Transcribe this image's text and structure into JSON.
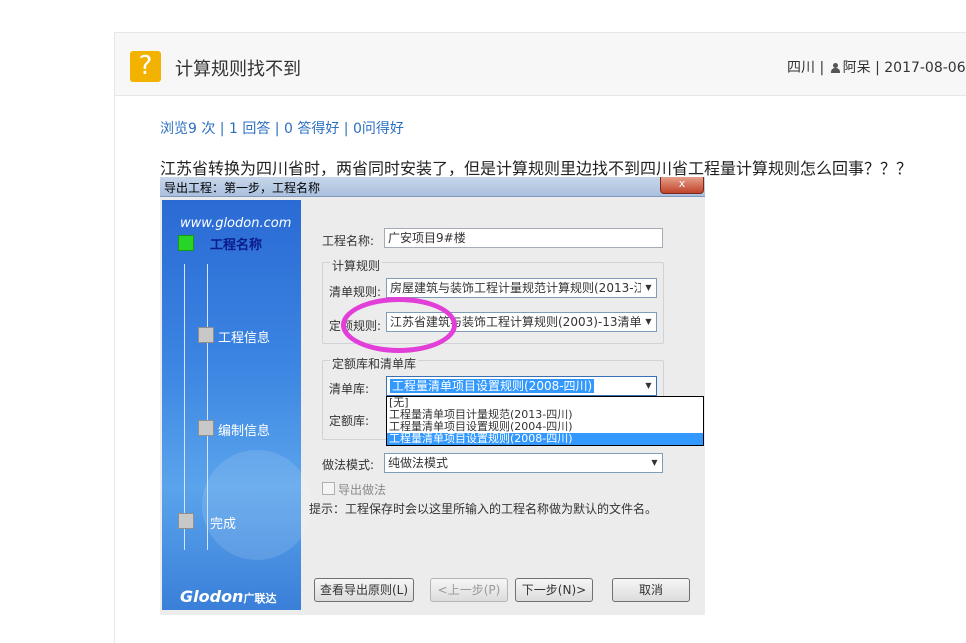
{
  "question": {
    "title": "计算规则找不到",
    "meta": {
      "region": "四川",
      "author": "阿呆",
      "date": "2017-08-06"
    },
    "stats": {
      "views": "浏览9 次",
      "answers": "1 回答",
      "good_answers": "0 答得好",
      "good_questions": "0问得好"
    },
    "text": "江苏省转换为四川省时，两省同时安装了，但是计算规则里边找不到四川省工程量计算规则怎么回事？？？"
  },
  "dialog": {
    "title": "导出工程：第一步，工程名称",
    "brand": "www.glodon.com",
    "footer_brand": "Glodon",
    "footer_brand_cn": "广联达",
    "steps": [
      "工程名称",
      "工程信息",
      "编制信息",
      "完成"
    ],
    "project_name_label": "工程名称:",
    "project_name_value": "广安项目9#楼",
    "calc_rules_group": "计算规则",
    "list_rule_label": "清单规则:",
    "list_rule_value": "房屋建筑与装饰工程计量规范计算规则(2013-江",
    "quota_rule_label": "定额规则:",
    "quota_rule_value": "江苏省建筑与装饰工程计算规则(2003)-13清单",
    "library_group": "定额库和清单库",
    "list_lib_label": "清单库:",
    "list_lib_value": "工程量清单项目设置规则(2008-四川)",
    "quota_lib_label": "定额库:",
    "dropdown_options": [
      "[无]",
      "工程量清单项目计量规范(2013-四川)",
      "工程量清单项目设置规则(2004-四川)",
      "工程量清单项目设置规则(2008-四川)"
    ],
    "method_label": "做法模式:",
    "method_value": "纯做法模式",
    "export_method_label": "导出做法",
    "hint": "提示：工程保存时会以这里所输入的工程名称做为默认的文件名。",
    "buttons": {
      "view_rules": "查看导出原则(L)",
      "prev": "<上一步(P)",
      "next": "下一步(N)>",
      "cancel": "取消"
    },
    "close_glyph": "x"
  }
}
